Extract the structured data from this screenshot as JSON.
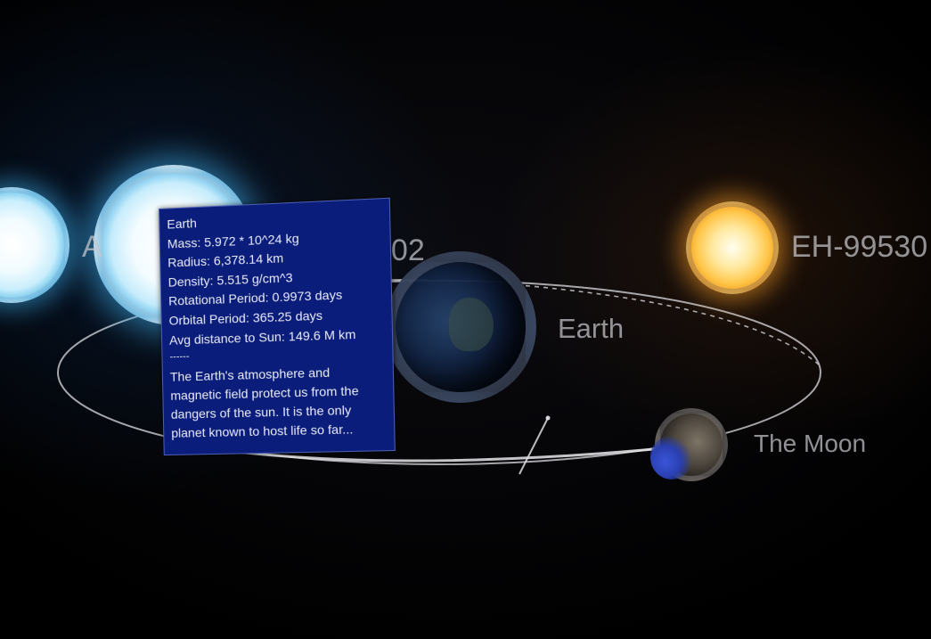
{
  "scene": {
    "labels": {
      "star_left_partial": "A",
      "star_near_partial": "A",
      "star_mid_partial": "602",
      "star_orange": "EH-99530",
      "earth": "Earth",
      "moon": "The Moon"
    }
  },
  "info_panel": {
    "title": "Earth",
    "mass": "Mass: 5.972 * 10^24 kg",
    "radius": "Radius: 6,378.14 km",
    "density": "Density: 5.515 g/cm^3",
    "rotational_period": "Rotational Period: 0.9973 days",
    "orbital_period": "Orbital Period: 365.25 days",
    "avg_distance": "Avg distance to Sun: 149.6 M km",
    "separator": "------",
    "description": "The Earth's atmosphere and magnetic field protect us from the dangers of the sun. It is the only planet known to host life so far..."
  },
  "colors": {
    "panel_background": "#0b1d7a",
    "blue_star": "#c6ecfb",
    "orange_star": "#ffc64a",
    "label_text": "#c8c8cd"
  }
}
